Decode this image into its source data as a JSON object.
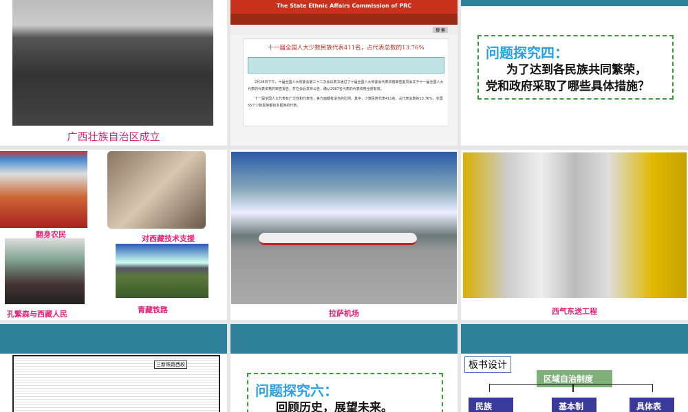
{
  "slides": [
    {
      "caption": "广西壮族自治区成立"
    },
    {
      "site_title": "The State Ethnic Affairs Commission of PRC",
      "headline": "十一届全国人大少数民族代表411名，占代表总数的13.76%",
      "search_button": "搜 索",
      "para1": "2月28日下午，十届全国人大常委会第三十二次会议表决通过了十届全国人大常委会代表资格审查委员会关于十一届全国人大代表的代表资格的审查报告，并在会后发布公告，确认2987名代表的代表资格全部有效。",
      "para2": "十一届全国人大代表有广泛性和代表性，各方面都有适当的比例。其中，少数民族代表411名，占代表总数的13.76%，全国55个少数民族都有本民族的代表。"
    },
    {
      "title": "问题探究四：",
      "text1": "为了达到各民族共同繁荣，",
      "text2": "党和政府采取了哪些具体措施？"
    },
    {
      "captions": [
        "翻身农民",
        "对西藏技术支援",
        "孔繁森与西藏人民",
        "青藏铁路"
      ]
    },
    {
      "caption": "拉萨机场"
    },
    {
      "caption": "西气东送工程"
    },
    {
      "map_label": "三新铁路西段"
    },
    {
      "title": "问题探究六：",
      "text1": "回顾历史，展望未来。"
    },
    {
      "board_label": "板书设计",
      "root": "区域自治制度",
      "children": [
        "民族",
        "基本制度",
        "具体表现"
      ]
    }
  ],
  "colors": {
    "teal": "#2f8099",
    "caption": "#e0247a"
  }
}
